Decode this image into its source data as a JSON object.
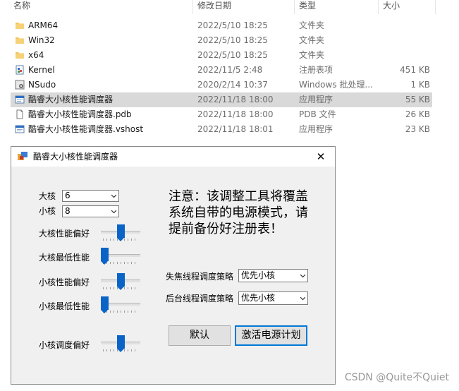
{
  "explorer": {
    "columns": {
      "name": "名称",
      "date": "修改日期",
      "type": "类型",
      "size": "大小"
    },
    "files": [
      {
        "name": "ARM64",
        "date": "2022/5/10 18:25",
        "type": "文件夹",
        "size": "",
        "icon": "folder-icon"
      },
      {
        "name": "Win32",
        "date": "2022/5/10 18:25",
        "type": "文件夹",
        "size": "",
        "icon": "folder-icon"
      },
      {
        "name": "x64",
        "date": "2022/5/10 18:25",
        "type": "文件夹",
        "size": "",
        "icon": "folder-icon"
      },
      {
        "name": "Kernel",
        "date": "2022/11/5 2:48",
        "type": "注册表项",
        "size": "451 KB",
        "icon": "registry-icon"
      },
      {
        "name": "NSudo",
        "date": "2020/2/14 10:37",
        "type": "Windows 批处理...",
        "size": "1 KB",
        "icon": "batch-icon"
      },
      {
        "name": "酷睿大小核性能调度器",
        "date": "2022/11/18 18:00",
        "type": "应用程序",
        "size": "55 KB",
        "icon": "app-icon",
        "selected": true
      },
      {
        "name": "酷睿大小核性能调度器.pdb",
        "date": "2022/11/18 18:00",
        "type": "PDB 文件",
        "size": "26 KB",
        "icon": "file-icon"
      },
      {
        "name": "酷睿大小核性能调度器.vshost",
        "date": "2022/11/18 18:01",
        "type": "应用程序",
        "size": "23 KB",
        "icon": "app-icon"
      }
    ]
  },
  "dialog": {
    "title": "酷睿大小核性能调度器",
    "close_glyph": "✕",
    "big_core_label": "大核",
    "big_core_value": "6",
    "small_core_label": "小核",
    "small_core_value": "8",
    "sliders": [
      {
        "label": "大核性能偏好",
        "level": 0.5
      },
      {
        "label": "大核最低性能",
        "level": 0.0
      },
      {
        "label": "小核性能偏好",
        "level": 0.5
      },
      {
        "label": "小核最低性能",
        "level": 0.0
      },
      {
        "label": "小核调度偏好",
        "level": 0.5
      }
    ],
    "notice": "注意：该调整工具将覆盖系统自带的电源模式，请提前备份好注册表！",
    "foreground_policy_label": "失焦线程调度策略",
    "foreground_policy_value": "优先小核",
    "background_policy_label": "后台线程调度策略",
    "background_policy_value": "优先小核",
    "default_button": "默认",
    "activate_button": "激活电源计划"
  },
  "watermark": "CSDN @Quite不Quiet",
  "colors": {
    "accent": "#0a64c8",
    "selection": "#d9d9d9",
    "folder": "#f2c55c"
  }
}
